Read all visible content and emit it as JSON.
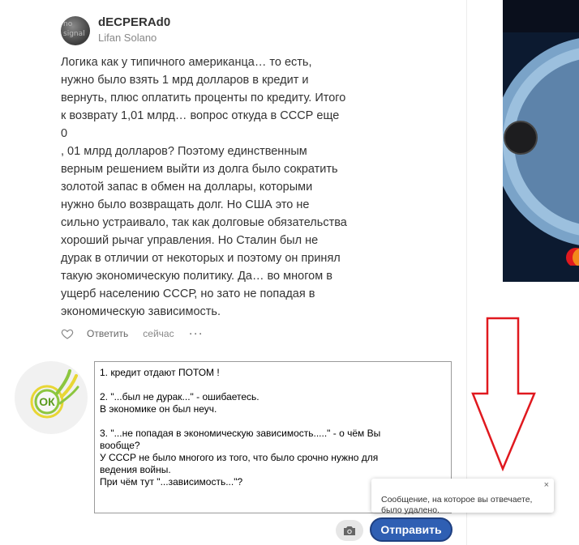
{
  "post": {
    "author": "dECPERAd0",
    "subtitle": "Lifan Solano",
    "avatar_text": "no\nsignal",
    "text": "Логика как у типичного американца… то есть,\nнужно было взять 1 мрд долларов в кредит и\nвернуть, плюс оплатить проценты по кредиту. Итого\nк возврату 1,01 млрд… вопрос откуда в СССР еще\n0\n, 01 млрд долларов? Поэтому единственным\nверным решением выйти из долга было сократить\nзолотой запас в обмен на доллары, которыми\nнужно было возвращать долг. Но США это не\nсильно устраивало, так как долговые обязательства\nхороший рычаг управления. Но Сталин был не\nдурак в отличии от некоторых и поэтому он принял\nтакую экономическую политику. Да… во многом в\nущерб населению СССР, но зато не попадая в\nэкономическую зависимость.",
    "actions": {
      "like_icon": "heart-icon",
      "reply": "Ответить",
      "time": "сейчас",
      "more": "···"
    }
  },
  "reply_form": {
    "avatar_logo": "ОК",
    "text": "1. кредит отдают ПОТОМ !\n\n2. \"...был не дурак...\" - ошибаетесь.\nВ экономике он был неуч.\n\n3. \"...не попадая в экономическую зависимость.....\" - о чём Вы\nвообще?\nУ СССР не было многого из  того, что было срочно нужно для\nведения войны.\nПри чём тут \"...зависимость...\"?",
    "camera_icon": "camera-icon",
    "send_label": "Отправить"
  },
  "toast": {
    "message": "Сообщение, на которое вы отвечаете,\nбыло удалено.",
    "close": "×"
  },
  "colors": {
    "send_button": "#2f5fb3",
    "arrow": "#e0191f",
    "ok_green": "#8cc63f",
    "ok_yellow": "#e8d634"
  }
}
